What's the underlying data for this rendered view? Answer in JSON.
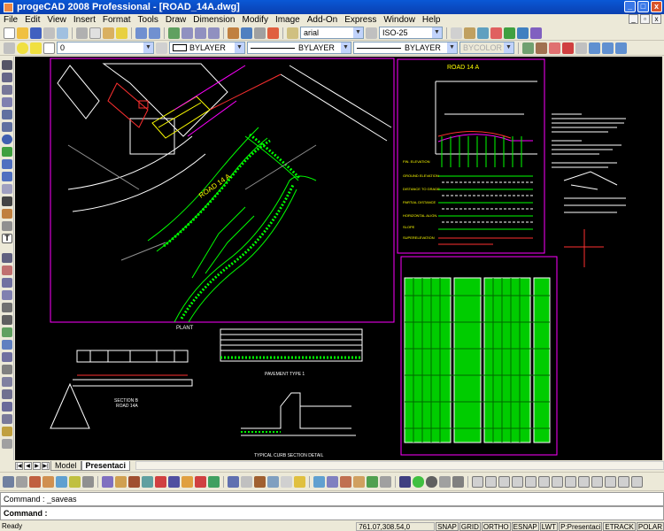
{
  "window": {
    "title": "progeCAD 2008 Professional - [ROAD_14A.dwg]",
    "min": "_",
    "max": "□",
    "close": "x"
  },
  "menu": [
    "File",
    "Edit",
    "View",
    "Insert",
    "Format",
    "Tools",
    "Draw",
    "Dimension",
    "Modify",
    "Image",
    "Add-On",
    "Express",
    "Window",
    "Help"
  ],
  "toolbar": {
    "font": "arial",
    "dimstyle": "ISO-25",
    "layer": "0",
    "color": "BYLAYER",
    "linetype": "BYLAYER",
    "lineweight": "BYLAYER",
    "plotstyle": "BYCOLOR"
  },
  "drawing": {
    "road_label": "ROAD 14 A",
    "profile_title": "ROAD 14 A",
    "plan_label": "PLANT",
    "section_title": "SECTION B",
    "section_sub": "ROAD 14A",
    "pavement_title": "PAVEMENT TYPE 1",
    "curb_title": "TYPICAL CURB SECTION DETAIL",
    "profile_rows": [
      "FIN. ELEVATION",
      "GROUND ELEVATION",
      "DISTANCE TO GRADE",
      "PARTIAL DISTANCE",
      "HORIZONTAL ALIGN.",
      "SLOPE",
      "SUPERELEVATION"
    ]
  },
  "tabs": [
    "Model",
    "Presentaci"
  ],
  "command": {
    "history": "Command : _saveas",
    "prompt": "Command :"
  },
  "status": {
    "ready": "Ready",
    "coords": "761.07,308.54,0",
    "buttons": [
      "SNAP",
      "GRID",
      "ORTHO",
      "ESNAP",
      "LWT",
      "P:Presentaci",
      "ETRACK",
      "POLAR"
    ]
  },
  "colors": {
    "canvas": "#000000",
    "green": "#00ff00",
    "magenta": "#ff00ff",
    "white": "#ffffff",
    "yellow": "#ffff00",
    "red": "#ff3030"
  }
}
